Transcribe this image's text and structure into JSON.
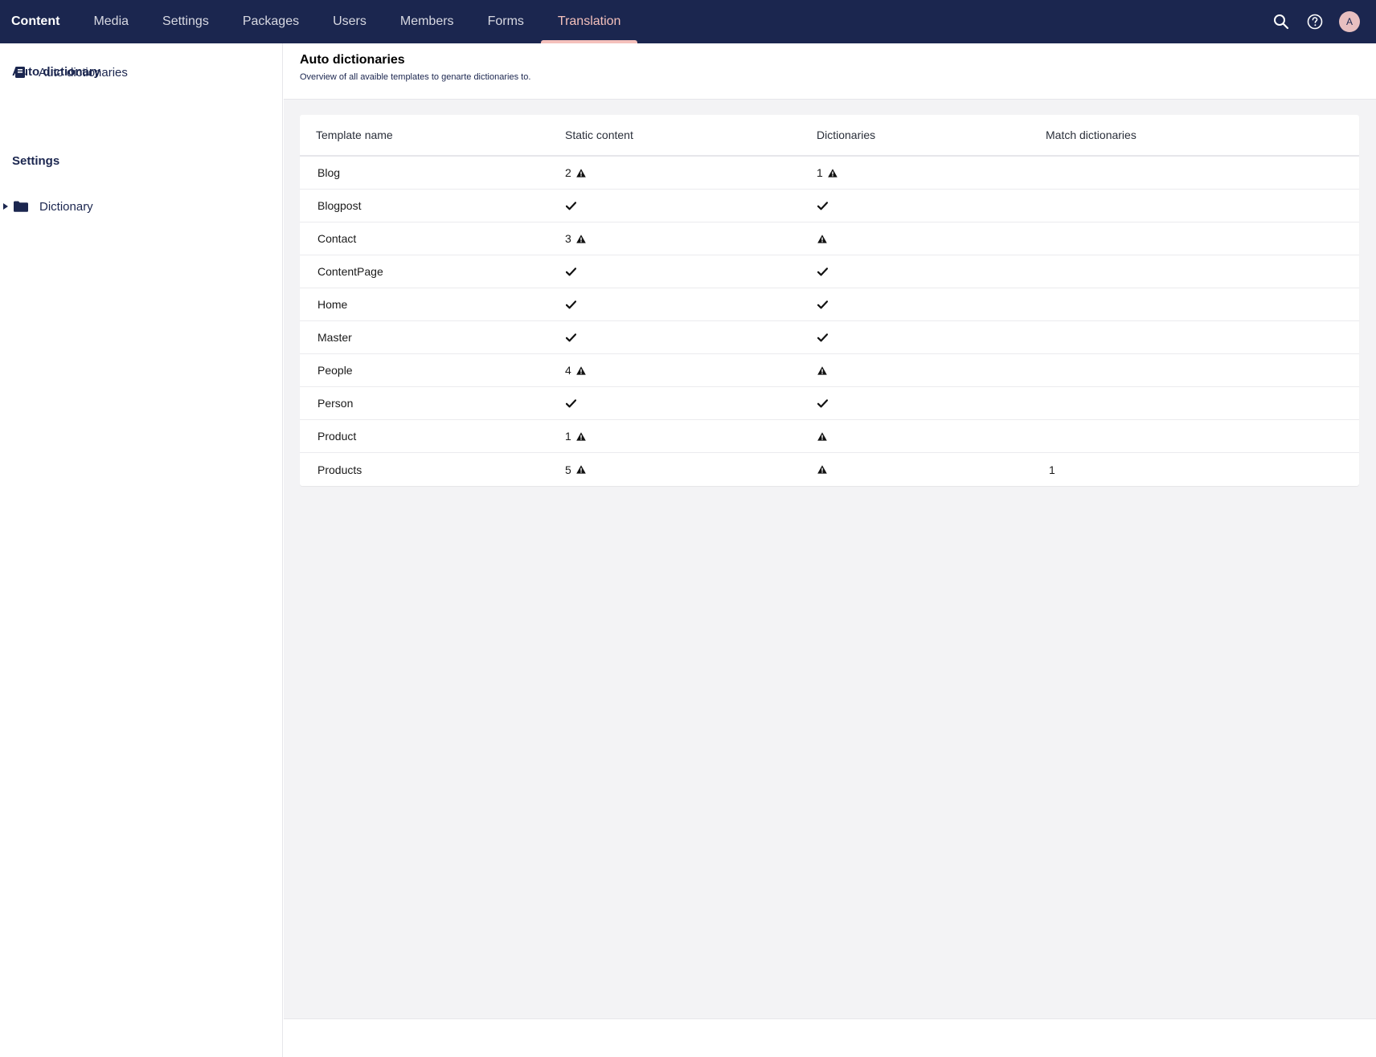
{
  "nav": {
    "items": [
      {
        "label": "Content",
        "name": "nav-content"
      },
      {
        "label": "Media",
        "name": "nav-media"
      },
      {
        "label": "Settings",
        "name": "nav-settings"
      },
      {
        "label": "Packages",
        "name": "nav-packages"
      },
      {
        "label": "Users",
        "name": "nav-users"
      },
      {
        "label": "Members",
        "name": "nav-members"
      },
      {
        "label": "Forms",
        "name": "nav-forms"
      },
      {
        "label": "Translation",
        "name": "nav-translation"
      }
    ],
    "active": "Translation",
    "avatar_initial": "A"
  },
  "sidebar": {
    "section1_heading": "Auto dictionary",
    "item1_label": "Auto dictionaries",
    "section2_heading": "Settings",
    "item2_label": "Dictionary"
  },
  "main": {
    "title": "Auto dictionaries",
    "description": "Overview of all avaible templates to genarte dictionaries to."
  },
  "table": {
    "headers": [
      "Template name",
      "Static content",
      "Dictionaries",
      "Match dictionaries"
    ],
    "rows": [
      {
        "name": "Blog",
        "static": {
          "count": "2",
          "status": "warning"
        },
        "dict": {
          "count": "1",
          "status": "warning"
        },
        "match": ""
      },
      {
        "name": "Blogpost",
        "static": {
          "count": "",
          "status": "ok"
        },
        "dict": {
          "count": "",
          "status": "ok"
        },
        "match": ""
      },
      {
        "name": "Contact",
        "static": {
          "count": "3",
          "status": "warning"
        },
        "dict": {
          "count": "",
          "status": "warning"
        },
        "match": ""
      },
      {
        "name": "ContentPage",
        "static": {
          "count": "",
          "status": "ok"
        },
        "dict": {
          "count": "",
          "status": "ok"
        },
        "match": ""
      },
      {
        "name": "Home",
        "static": {
          "count": "",
          "status": "ok"
        },
        "dict": {
          "count": "",
          "status": "ok"
        },
        "match": ""
      },
      {
        "name": "Master",
        "static": {
          "count": "",
          "status": "ok"
        },
        "dict": {
          "count": "",
          "status": "ok"
        },
        "match": ""
      },
      {
        "name": "People",
        "static": {
          "count": "4",
          "status": "warning"
        },
        "dict": {
          "count": "",
          "status": "warning"
        },
        "match": ""
      },
      {
        "name": "Person",
        "static": {
          "count": "",
          "status": "ok"
        },
        "dict": {
          "count": "",
          "status": "ok"
        },
        "match": ""
      },
      {
        "name": "Product",
        "static": {
          "count": "1",
          "status": "warning"
        },
        "dict": {
          "count": "",
          "status": "warning"
        },
        "match": ""
      },
      {
        "name": "Products",
        "static": {
          "count": "5",
          "status": "warning"
        },
        "dict": {
          "count": "",
          "status": "warning"
        },
        "match": "1"
      }
    ]
  },
  "icons": {
    "ok": "checkmark-icon",
    "warning": "warning-icon"
  },
  "colors": {
    "topbar": "#1b264f",
    "active_nav": "#f5c1bc",
    "main_bg": "#f3f3f5"
  }
}
